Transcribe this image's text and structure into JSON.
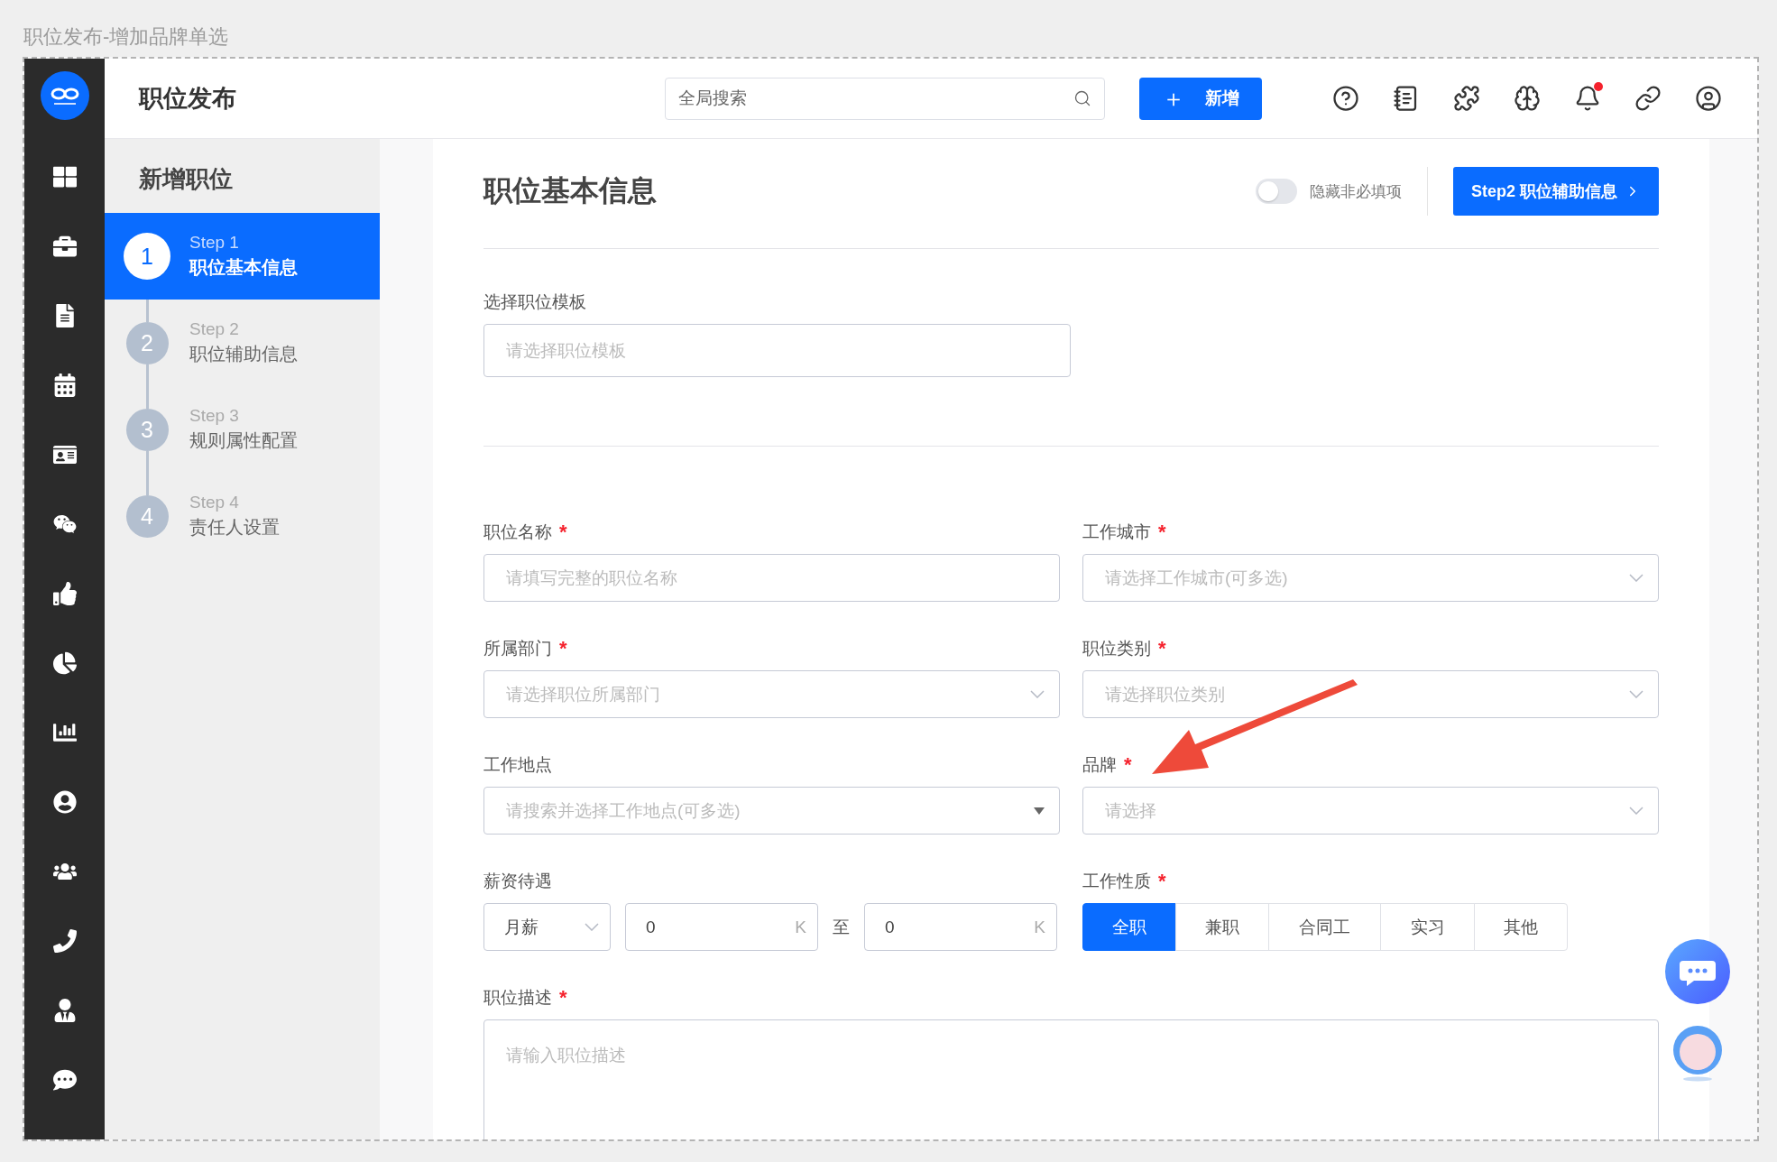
{
  "caption": "职位发布-增加品牌单选",
  "header": {
    "title": "职位发布",
    "search": {
      "placeholder": "全局搜索"
    },
    "new_button": {
      "icon": "＋",
      "label": "新增"
    },
    "notifications": {
      "unread": true
    }
  },
  "steps_panel": {
    "title": "新增职位",
    "steps": [
      {
        "number": "1",
        "step": "Step 1",
        "label": "职位基本信息",
        "selected": true
      },
      {
        "number": "2",
        "step": "Step 2",
        "label": "职位辅助信息",
        "selected": false
      },
      {
        "number": "3",
        "step": "Step 3",
        "label": "规则属性配置",
        "selected": false
      },
      {
        "number": "4",
        "step": "Step 4",
        "label": "责任人设置",
        "selected": false
      }
    ]
  },
  "form": {
    "title": "职位基本信息",
    "hide_optional": {
      "label": "隐藏非必填项",
      "on": false
    },
    "next_button": "Step2 职位辅助信息",
    "template": {
      "label": "选择职位模板",
      "placeholder": "请选择职位模板"
    },
    "fields": [
      {
        "label": "职位名称",
        "required_mark": "*",
        "kind": "text",
        "placeholder": "请填写完整的职位名称"
      },
      {
        "label": "工作城市",
        "required_mark": "*",
        "kind": "select",
        "placeholder": "请选择工作城市(可多选)"
      },
      {
        "label": "所属部门",
        "required_mark": "*",
        "kind": "select",
        "placeholder": "请选择职位所属部门"
      },
      {
        "label": "职位类别",
        "required_mark": "*",
        "kind": "select",
        "placeholder": "请选择职位类别"
      },
      {
        "label": "工作地点",
        "kind": "search-select",
        "placeholder": "请搜索并选择工作地点(可多选)"
      },
      {
        "label": "品牌",
        "required_mark": "*",
        "kind": "select",
        "placeholder": "请选择"
      }
    ],
    "salary": {
      "label": "薪资待遇",
      "period": "月薪",
      "from": "0",
      "from_unit": "K",
      "separator": "至",
      "to": "0",
      "to_unit": "K"
    },
    "job_type": {
      "label": "工作性质",
      "required_mark": "*",
      "options": [
        {
          "label": "全职",
          "selected": true
        },
        {
          "label": "兼职",
          "selected": false
        },
        {
          "label": "合同工",
          "selected": false
        },
        {
          "label": "实习",
          "selected": false
        },
        {
          "label": "其他",
          "selected": false
        }
      ]
    },
    "description": {
      "label": "职位描述",
      "required_mark": "*",
      "placeholder": "请输入职位描述"
    }
  }
}
